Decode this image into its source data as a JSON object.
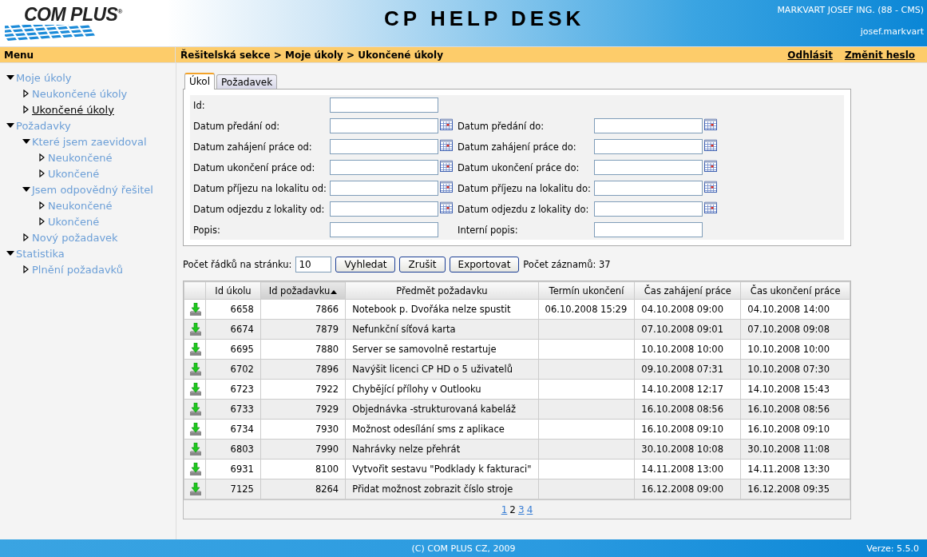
{
  "header": {
    "logo": {
      "text": "COM PLUS",
      "mark": "®"
    },
    "title": "CP HELP DESK",
    "user": "MARKVART JOSEF ING. (88 - CMS)",
    "login": "josef.markvart"
  },
  "menu_bar": {
    "title": "Menu",
    "breadcrumb": "Řešitelská sekce > Moje úkoly > Ukončené úkoly",
    "links": [
      "Odhlásit",
      "Změnit heslo"
    ]
  },
  "sidebar": {
    "items": [
      {
        "label": "Moje úkoly",
        "expanded": true,
        "selected": false,
        "children": [
          {
            "label": "Neukončené úkoly",
            "expanded": false,
            "selected": false
          },
          {
            "label": "Ukončené úkoly",
            "expanded": false,
            "selected": true
          }
        ]
      },
      {
        "label": "Požadavky",
        "expanded": true,
        "selected": false,
        "children": [
          {
            "label": "Které jsem zaevidoval",
            "expanded": true,
            "selected": false,
            "children": [
              {
                "label": "Neukončené",
                "expanded": false,
                "selected": false
              },
              {
                "label": "Ukončené",
                "expanded": false,
                "selected": false
              }
            ]
          },
          {
            "label": "Jsem odpovědný řešitel",
            "expanded": true,
            "selected": false,
            "children": [
              {
                "label": "Neukončené",
                "expanded": false,
                "selected": false
              },
              {
                "label": "Ukončené",
                "expanded": false,
                "selected": false
              }
            ]
          },
          {
            "label": "Nový požadavek",
            "expanded": false,
            "selected": false
          }
        ]
      },
      {
        "label": "Statistika",
        "expanded": true,
        "selected": false,
        "children": [
          {
            "label": "Plnění požadavků",
            "expanded": false,
            "selected": false
          }
        ]
      }
    ]
  },
  "tabs": [
    {
      "label": "Úkol",
      "selected": true
    },
    {
      "label": "Požadavek",
      "selected": false
    }
  ],
  "form": {
    "rows": [
      {
        "left": {
          "label": "Id:",
          "calendar": false
        }
      },
      {
        "left": {
          "label": "Datum předání od:",
          "calendar": true
        },
        "right": {
          "label": "Datum předání do:",
          "calendar": true
        }
      },
      {
        "left": {
          "label": "Datum zahájení práce od:",
          "calendar": true
        },
        "right": {
          "label": "Datum zahájení práce do:",
          "calendar": true
        }
      },
      {
        "left": {
          "label": "Datum ukončení práce od:",
          "calendar": true
        },
        "right": {
          "label": "Datum ukončení práce do:",
          "calendar": true
        }
      },
      {
        "left": {
          "label": "Datum příjezu na lokalitu od:",
          "calendar": true
        },
        "right": {
          "label": "Datum příjezu na lokalitu do:",
          "calendar": true
        }
      },
      {
        "left": {
          "label": "Datum odjezdu z lokality od:",
          "calendar": true
        },
        "right": {
          "label": "Datum odjezdu z lokality do:",
          "calendar": true
        }
      },
      {
        "left": {
          "label": "Popis:",
          "calendar": false
        },
        "right": {
          "label": "Interní popis:",
          "calendar": false
        }
      }
    ]
  },
  "toolbar": {
    "rows_label": "Počet řádků na stránku:",
    "rows_value": "10",
    "buttons": [
      "Vyhledat",
      "Zrušit",
      "Exportovat"
    ],
    "count": "Počet záznamů: 37"
  },
  "table": {
    "columns": [
      {
        "sorted": false
      },
      {
        "label": "Id úkolu",
        "sorted": false
      },
      {
        "label": "Id požadavku",
        "sorted": true
      },
      {
        "label": "Předmět požadavku",
        "sorted": false
      },
      {
        "label": "Termín ukončení",
        "sorted": false
      },
      {
        "label": "Čas zahájení práce",
        "sorted": false
      },
      {
        "label": "Čas ukončení práce",
        "sorted": false
      }
    ],
    "rows": [
      [
        "",
        "6658",
        "7866",
        "Notebook p. Dvořáka nelze spustit",
        "06.10.2008 15:29",
        "04.10.2008 09:00",
        "04.10.2008 14:00"
      ],
      [
        "",
        "6674",
        "7879",
        "Nefunkční síťová karta",
        "",
        "07.10.2008 09:01",
        "07.10.2008 09:08"
      ],
      [
        "",
        "6695",
        "7880",
        "Server se samovolně restartuje",
        "",
        "10.10.2008 10:00",
        "10.10.2008 10:00"
      ],
      [
        "",
        "6702",
        "7896",
        "Navýšit licenci CP HD o 5 uživatelů",
        "",
        "09.10.2008 07:31",
        "10.10.2008 07:30"
      ],
      [
        "",
        "6723",
        "7922",
        "Chybějící přílohy v Outlooku",
        "",
        "14.10.2008 12:17",
        "14.10.2008 15:43"
      ],
      [
        "",
        "6733",
        "7929",
        "Objednávka -strukturovaná kabeláž",
        "",
        "16.10.2008 08:56",
        "16.10.2008 08:56"
      ],
      [
        "",
        "6734",
        "7930",
        "Možnost odesílání sms z aplikace",
        "",
        "16.10.2008 09:10",
        "16.10.2008 09:10"
      ],
      [
        "",
        "6803",
        "7990",
        "Nahrávky nelze přehrát",
        "",
        "30.10.2008 10:08",
        "30.10.2008 11:08"
      ],
      [
        "",
        "6931",
        "8100",
        "Vytvořit sestavu \"Podklady k fakturaci\"",
        "",
        "14.11.2008 13:00",
        "14.11.2008 13:30"
      ],
      [
        "",
        "7125",
        "8264",
        "Přidat možnost zobrazit číslo stroje",
        "",
        "16.12.2008 09:00",
        "16.12.2008 09:35"
      ]
    ],
    "pages": [
      {
        "label": "1",
        "selected": false
      },
      {
        "label": "2",
        "selected": true
      },
      {
        "label": "3",
        "selected": false
      },
      {
        "label": "4",
        "selected": false
      }
    ]
  },
  "footer": {
    "copyright": "(C) COM PLUS CZ, 2009",
    "version": "Verze: 5.5.0"
  }
}
